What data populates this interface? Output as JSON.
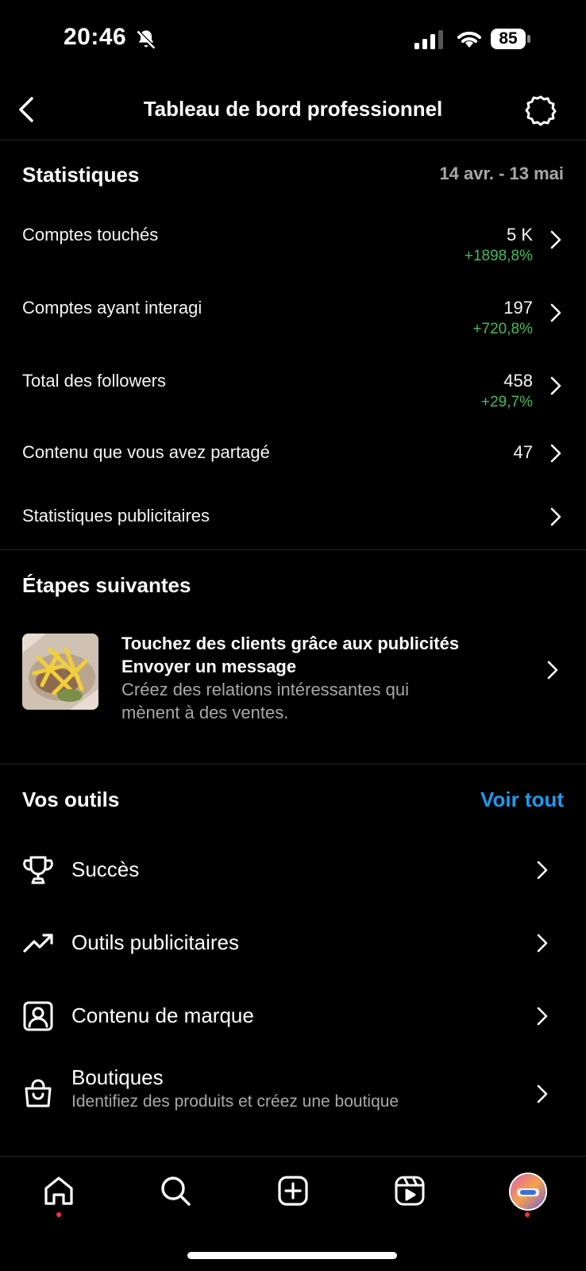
{
  "status": {
    "time": "20:46",
    "battery": "85"
  },
  "header": {
    "title": "Tableau de bord professionnel"
  },
  "stats": {
    "title": "Statistiques",
    "range": "14 avr. - 13 mai",
    "rows": [
      {
        "label": "Comptes touchés",
        "value": "5 K",
        "delta": "+1898,8%"
      },
      {
        "label": "Comptes ayant interagi",
        "value": "197",
        "delta": "+720,8%"
      },
      {
        "label": "Total des followers",
        "value": "458",
        "delta": "+29,7%"
      },
      {
        "label": "Contenu que vous avez partagé",
        "value": "47"
      },
      {
        "label": "Statistiques publicitaires"
      }
    ]
  },
  "next_steps": {
    "title": "Étapes suivantes",
    "card": {
      "line1": "Touchez des clients grâce aux publicités",
      "line2": "Envoyer un message",
      "desc1": "Créez des relations intéressantes qui",
      "desc2": "mènent à des ventes."
    }
  },
  "tools": {
    "title": "Vos outils",
    "see_all": "Voir tout",
    "items": [
      {
        "label": "Succès",
        "icon": "trophy-icon"
      },
      {
        "label": "Outils publicitaires",
        "icon": "trending-up-icon"
      },
      {
        "label": "Contenu de marque",
        "icon": "branded-content-icon"
      },
      {
        "label": "Boutiques",
        "sub": "Identifiez des produits et créez une boutique",
        "icon": "shopping-bag-icon"
      }
    ]
  },
  "tabbar": {
    "items": [
      "home-icon",
      "search-icon",
      "create-icon",
      "reels-icon",
      "profile-avatar"
    ]
  },
  "colors": {
    "accent": "#1d9bf0",
    "positive": "#3fbe5a",
    "notification": "#ff3040"
  }
}
